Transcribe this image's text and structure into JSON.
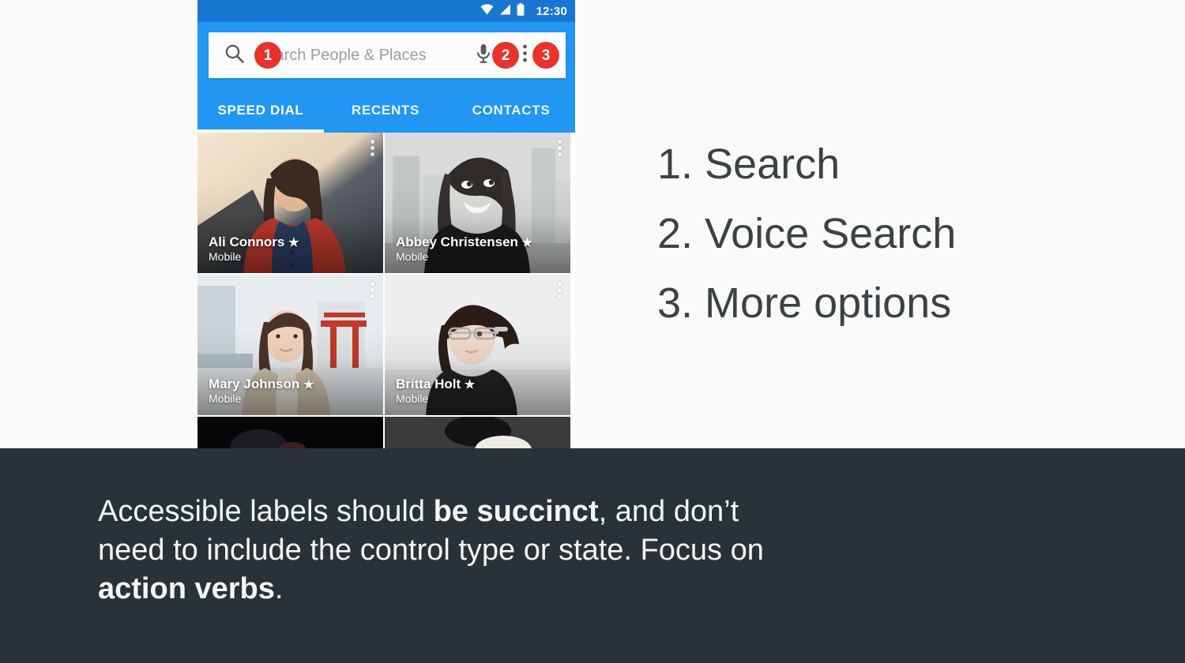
{
  "page": {
    "background_color": "#fafafa"
  },
  "phone": {
    "statusbar": {
      "time": "12:30",
      "icons": [
        "wifi-icon",
        "cellular-signal-icon",
        "battery-icon"
      ],
      "background_color": "#1876d1"
    },
    "appbar": {
      "background_color": "#2196f3",
      "search": {
        "placeholder": "Search People  & Places",
        "search_icon": "search-icon",
        "mic_icon": "microphone-icon",
        "overflow_icon": "more-vert-icon"
      },
      "badges": [
        {
          "number": "1",
          "target": "search-icon",
          "color": "#e8322a"
        },
        {
          "number": "2",
          "target": "microphone-icon",
          "color": "#e8322a"
        },
        {
          "number": "3",
          "target": "more-vert-icon",
          "color": "#e8322a"
        }
      ],
      "tabs": [
        {
          "label": "SPEED DIAL",
          "active": true
        },
        {
          "label": "RECENTS",
          "active": false
        },
        {
          "label": "CONTACTS",
          "active": false
        }
      ]
    },
    "contacts": [
      {
        "name": "Ali Connors",
        "starred": true,
        "star": "★",
        "subtitle": "Mobile",
        "overflow_icon": "more-vert-icon"
      },
      {
        "name": "Abbey Christensen",
        "starred": true,
        "star": "★",
        "subtitle": "Mobile",
        "overflow_icon": "more-vert-icon"
      },
      {
        "name": "Mary Johnson",
        "starred": true,
        "star": "★",
        "subtitle": "Mobile",
        "overflow_icon": "more-vert-icon"
      },
      {
        "name": "Britta Holt",
        "starred": true,
        "star": "★",
        "subtitle": "Mobile",
        "overflow_icon": "more-vert-icon"
      }
    ]
  },
  "annotations": {
    "items": [
      {
        "text": "1. Search"
      },
      {
        "text": "2. Voice Search"
      },
      {
        "text": "3. More options"
      }
    ],
    "text_color": "#3b4246"
  },
  "footer": {
    "background_color": "#293239",
    "caption": {
      "part1": "Accessible labels should ",
      "bold1": "be succinct",
      "part2": ", and don’t need to include the control type or state. Focus on ",
      "bold2": "action verbs",
      "part3": "."
    }
  }
}
